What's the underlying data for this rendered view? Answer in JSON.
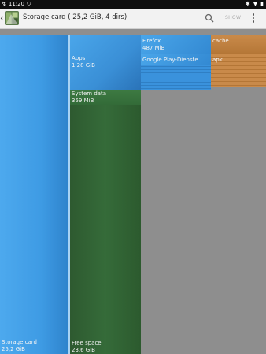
{
  "status_bar": {
    "time": "11:20",
    "left_icons": [
      "notification-icon",
      "shield-icon"
    ],
    "right_icons": [
      "bluetooth-icon",
      "wifi-icon",
      "battery-icon"
    ]
  },
  "appbar": {
    "title": "Storage card ( 25,2 GiB, 4 dirs)",
    "show_label": "SHOW"
  },
  "treemap": {
    "storage_card": {
      "name": "Storage card",
      "size": "25,2 GiB"
    },
    "apps": {
      "name": "Apps",
      "size": "1,28 GiB"
    },
    "firefox": {
      "name": "Firefox",
      "size": "487 MiB"
    },
    "google_play": {
      "name": "Google Play-Dienste"
    },
    "cache": {
      "name": "cache"
    },
    "apk": {
      "name": "apk"
    },
    "system_data": {
      "name": "System data",
      "size": "359 MiB"
    },
    "free_space": {
      "name": "Free space",
      "size": "23,6 GiB"
    }
  },
  "colors": {
    "blue": "#3e9be4",
    "green": "#356b39",
    "orange": "#c98a4a",
    "background": "#8e8e8e"
  }
}
